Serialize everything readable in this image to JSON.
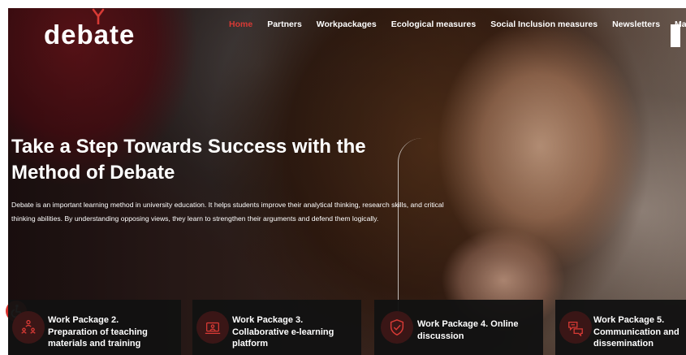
{
  "header": {
    "logo_text": "debate",
    "nav": [
      {
        "label": "Home",
        "active": true
      },
      {
        "label": "Partners",
        "active": false
      },
      {
        "label": "Workpackages",
        "active": false
      },
      {
        "label": "Ecological measures",
        "active": false
      },
      {
        "label": "Social Inclusion measures",
        "active": false
      },
      {
        "label": "Newsletters",
        "active": false
      },
      {
        "label": "Manual",
        "active": false
      }
    ]
  },
  "hero": {
    "title_line1": "Take a Step Towards Success with the",
    "title_line2": "Method of Debate",
    "description": "Debate is an important learning method in university education. It helps students improve their analytical thinking, research skills, and critical thinking abilities. By understanding opposing views, they learn to strengthen their arguments and defend them logically."
  },
  "cards": [
    {
      "line1": "Work Package 2.",
      "line2": "Preparation of teaching",
      "line3": "materials and training",
      "icon": "people-network-icon"
    },
    {
      "line1": "Work Package 3.",
      "line2": "Collaborative e-learning",
      "line3": "platform",
      "icon": "elearning-screen-icon"
    },
    {
      "line1": "Work Package 4. Online",
      "line2": "discussion",
      "icon": "shield-check-icon"
    },
    {
      "line1": "Work Package 5.",
      "line2": "Communication and",
      "line3": "dissemination",
      "icon": "chat-bubbles-icon"
    }
  ],
  "colors": {
    "accent": "#d83a35",
    "card_background": "#121212",
    "icon_circle": "#3a1616"
  }
}
